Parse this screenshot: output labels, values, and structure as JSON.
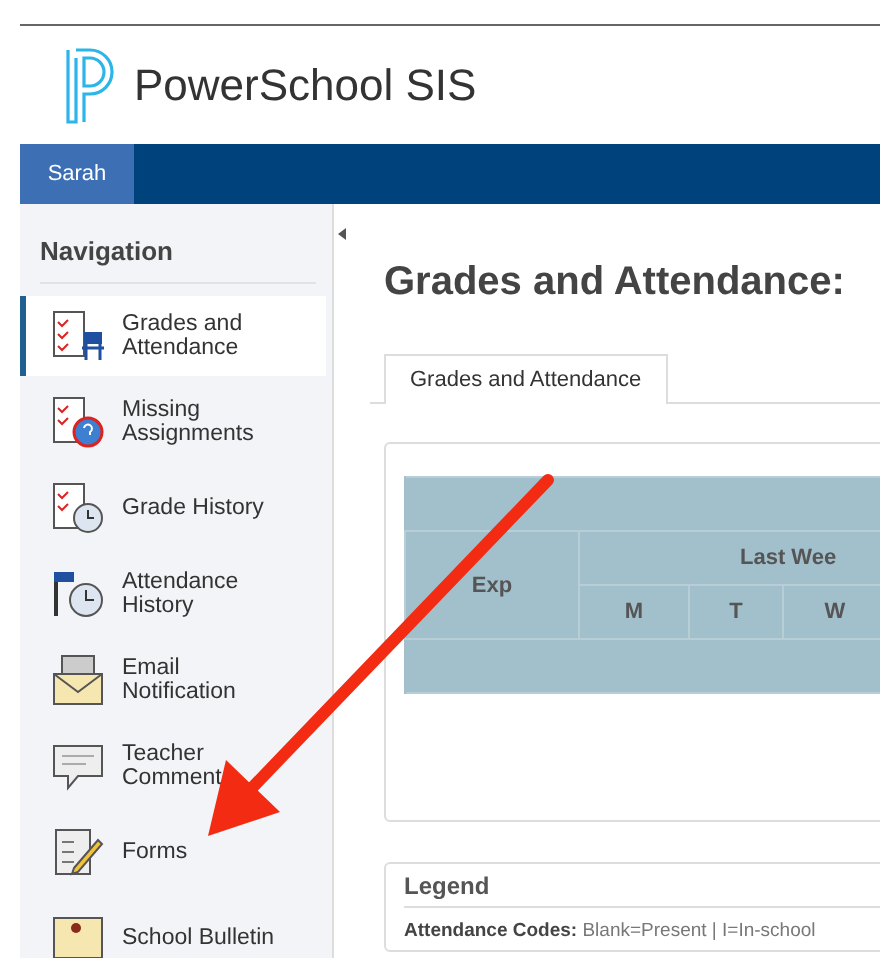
{
  "header": {
    "brand": "PowerSchool SIS"
  },
  "top_bar": {
    "user_tab": "Sarah"
  },
  "sidebar": {
    "title": "Navigation",
    "items": [
      {
        "label": "Grades and Attendance",
        "selected": true
      },
      {
        "label": "Missing Assignments",
        "selected": false
      },
      {
        "label": "Grade History",
        "selected": false
      },
      {
        "label": "Attendance History",
        "selected": false
      },
      {
        "label": "Email Notification",
        "selected": false
      },
      {
        "label": "Teacher Comment",
        "selected": false
      },
      {
        "label": "Forms",
        "selected": false
      },
      {
        "label": "School Bulletin",
        "selected": false
      }
    ]
  },
  "main": {
    "title": "Grades and Attendance:",
    "tabs": [
      {
        "label": "Grades and Attendance"
      }
    ],
    "table": {
      "columns": [
        "Exp",
        "Last Wee"
      ],
      "days": [
        "M",
        "T",
        "W"
      ]
    },
    "legend": {
      "title": "Legend",
      "text": "**Attendance Codes:**  Blank=Present | I=In-school"
    }
  }
}
